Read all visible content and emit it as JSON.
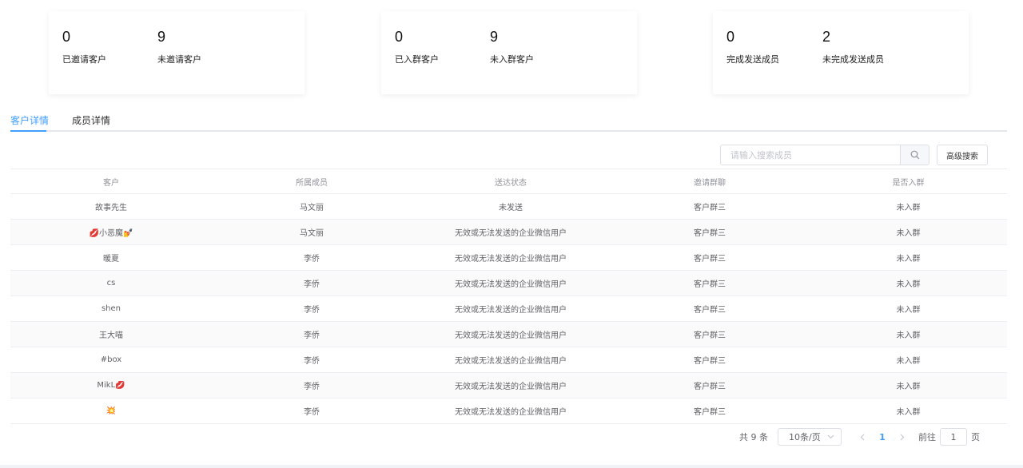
{
  "stats": [
    {
      "a_num": "0",
      "a_label": "已邀请客户",
      "b_num": "9",
      "b_label": "未邀请客户"
    },
    {
      "a_num": "0",
      "a_label": "已入群客户",
      "b_num": "9",
      "b_label": "未入群客户"
    },
    {
      "a_num": "0",
      "a_label": "完成发送成员",
      "b_num": "2",
      "b_label": "未完成发送成员"
    }
  ],
  "tabs": [
    {
      "label": "客户详情",
      "active": true
    },
    {
      "label": "成员详情",
      "active": false
    }
  ],
  "search": {
    "placeholder": "请输入搜索成员",
    "icon": "search-icon",
    "advanced_label": "高级搜索"
  },
  "table": {
    "columns": [
      "客户",
      "所属成员",
      "送达状态",
      "邀请群聊",
      "是否入群"
    ],
    "rows": [
      [
        "故事先生",
        "马文丽",
        "未发送",
        "客户群三",
        "未入群"
      ],
      [
        "💋小恶魔💅",
        "马文丽",
        "无效或无法发送的企业微信用户",
        "客户群三",
        "未入群"
      ],
      [
        "暖夏",
        "李侨",
        "无效或无法发送的企业微信用户",
        "客户群三",
        "未入群"
      ],
      [
        "cs",
        "李侨",
        "无效或无法发送的企业微信用户",
        "客户群三",
        "未入群"
      ],
      [
        "shen",
        "李侨",
        "无效或无法发送的企业微信用户",
        "客户群三",
        "未入群"
      ],
      [
        "王大喵",
        "李侨",
        "无效或无法发送的企业微信用户",
        "客户群三",
        "未入群"
      ],
      [
        "#box",
        "李侨",
        "无效或无法发送的企业微信用户",
        "客户群三",
        "未入群"
      ],
      [
        "MikL💋",
        "李侨",
        "无效或无法发送的企业微信用户",
        "客户群三",
        "未入群"
      ],
      [
        "💥",
        "李侨",
        "无效或无法发送的企业微信用户",
        "客户群三",
        "未入群"
      ]
    ]
  },
  "pagination": {
    "total_text": "共 9 条",
    "page_size": "10条/页",
    "current_page": "1",
    "goto_prefix": "前往",
    "goto_value": "1",
    "goto_suffix": "页"
  },
  "colors": {
    "accent": "#409eff",
    "border": "#ebeef5",
    "stripe": "#fafafa"
  }
}
